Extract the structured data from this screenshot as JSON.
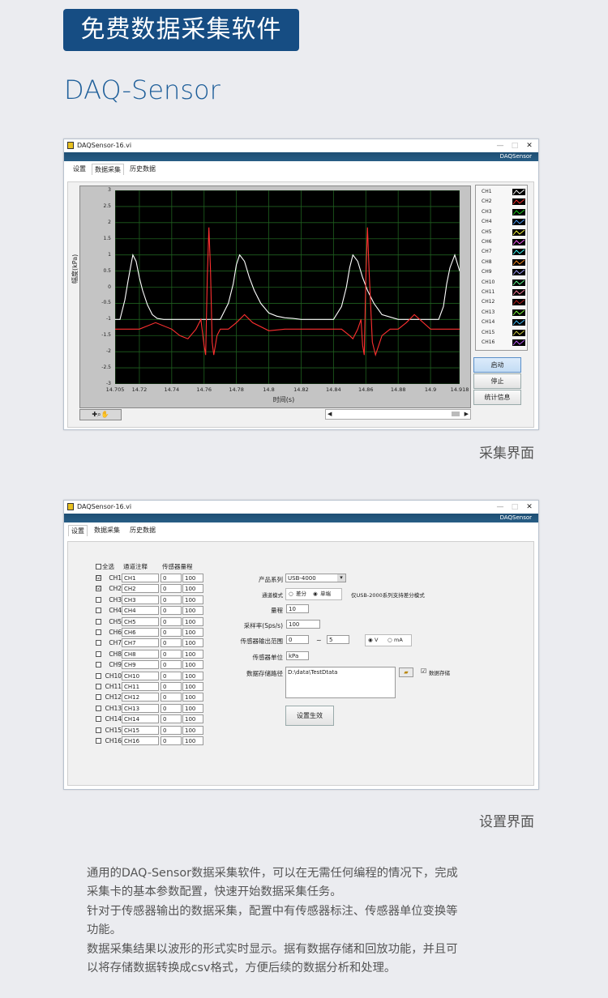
{
  "banner": "免费数据采集软件",
  "product": "DAQ-Sensor",
  "window": {
    "title": "DAQSensor-16.vi",
    "brand": "DAQSensor",
    "controls": [
      "—",
      "□",
      "✕"
    ],
    "tabs": [
      "设置",
      "数据采集",
      "历史数据"
    ]
  },
  "acq": {
    "yaxis_label": "幅度(kPa)",
    "xaxis_label": "时间(s)",
    "y_ticks": [
      "3",
      "2.5",
      "2",
      "1.5",
      "1",
      "0.5",
      "0",
      "-0.5",
      "-1",
      "-1.5",
      "-2",
      "-2.5",
      "-3"
    ],
    "x_ticks": [
      "14.705",
      "14.72",
      "14.74",
      "14.76",
      "14.78",
      "14.8",
      "14.82",
      "14.84",
      "14.86",
      "14.88",
      "14.9",
      "14.918"
    ],
    "legend": [
      "CH1",
      "CH2",
      "CH3",
      "CH4",
      "CH5",
      "CH6",
      "CH7",
      "CH8",
      "CH9",
      "CH10",
      "CH11",
      "CH12",
      "CH13",
      "CH14",
      "CH15",
      "CH16"
    ],
    "legend_colors": [
      "#ffffff",
      "#ff3030",
      "#20d020",
      "#4aa0ff",
      "#ffff40",
      "#ff60ff",
      "#40ffff",
      "#ff9020",
      "#a0a0ff",
      "#60ff90",
      "#ff80a0",
      "#c02020",
      "#80ff40",
      "#40c0ff",
      "#d0d040",
      "#c060ff"
    ],
    "buttons": {
      "start": "启动",
      "stop": "停止",
      "stats": "统计信息"
    },
    "caption": "采集界面"
  },
  "chart_data": {
    "type": "line",
    "xlabel": "时间(s)",
    "ylabel": "幅度(kPa)",
    "xlim": [
      14.705,
      14.918
    ],
    "ylim": [
      -3,
      3
    ],
    "grid": true,
    "series": [
      {
        "name": "CH1",
        "color": "#ffffff",
        "x": [
          14.705,
          14.708,
          14.711,
          14.713,
          14.715,
          14.716,
          14.718,
          14.72,
          14.722,
          14.725,
          14.728,
          14.731,
          14.735,
          14.74,
          14.745,
          14.75,
          14.76,
          14.77,
          14.775,
          14.778,
          14.78,
          14.782,
          14.785,
          14.788,
          14.791,
          14.795,
          14.8,
          14.805,
          14.81,
          14.815,
          14.82,
          14.83,
          14.84,
          14.845,
          14.848,
          14.85,
          14.852,
          14.855,
          14.858,
          14.861,
          14.865,
          14.87,
          14.88,
          14.89,
          14.9,
          14.905,
          14.908,
          14.91,
          14.912,
          14.915,
          14.918
        ],
        "values": [
          -1.0,
          -1.0,
          -0.4,
          0.2,
          0.75,
          1.0,
          0.8,
          0.3,
          -0.1,
          -0.55,
          -0.85,
          -0.97,
          -1.0,
          -1.0,
          -1.0,
          -1.0,
          -1.0,
          -1.0,
          -0.5,
          0.1,
          0.7,
          1.0,
          0.8,
          0.3,
          -0.1,
          -0.5,
          -0.8,
          -0.9,
          -0.95,
          -0.97,
          -1.0,
          -1.0,
          -1.0,
          -0.6,
          0.0,
          0.6,
          1.0,
          0.8,
          0.3,
          -0.1,
          -0.5,
          -0.85,
          -1.0,
          -1.0,
          -1.0,
          -1.0,
          -0.6,
          0.1,
          0.6,
          1.0,
          0.5
        ]
      },
      {
        "name": "CH2",
        "color": "#ff3030",
        "x": [
          14.705,
          14.71,
          14.72,
          14.73,
          14.74,
          14.745,
          14.75,
          14.755,
          14.758,
          14.76,
          14.761,
          14.762,
          14.763,
          14.764,
          14.765,
          14.766,
          14.768,
          14.77,
          14.775,
          14.78,
          14.785,
          14.79,
          14.8,
          14.81,
          14.82,
          14.83,
          14.84,
          14.845,
          14.85,
          14.852,
          14.855,
          14.857,
          14.858,
          14.859,
          14.86,
          14.861,
          14.862,
          14.864,
          14.866,
          14.87,
          14.875,
          14.88,
          14.885,
          14.89,
          14.9,
          14.91,
          14.918
        ],
        "values": [
          -1.3,
          -1.3,
          -1.3,
          -1.1,
          -1.3,
          -1.5,
          -1.6,
          -1.3,
          -1.0,
          -1.8,
          -2.1,
          0.3,
          1.85,
          0.5,
          -1.7,
          -2.1,
          -1.5,
          -1.3,
          -1.3,
          -1.1,
          -0.85,
          -1.1,
          -1.35,
          -1.3,
          -1.3,
          -1.3,
          -1.3,
          -1.3,
          -1.5,
          -1.6,
          -1.3,
          -1.0,
          -1.8,
          -2.1,
          0.3,
          1.85,
          0.5,
          -1.7,
          -2.1,
          -1.5,
          -1.3,
          -1.3,
          -1.1,
          -0.85,
          -1.3,
          -1.3,
          -1.3
        ]
      }
    ]
  },
  "settings": {
    "headers": {
      "all": "全选",
      "note": "通道注释",
      "range": "传感器量程"
    },
    "channels": [
      {
        "label": "CH1",
        "note": "CH1",
        "lo": "0",
        "hi": "100",
        "checked": "☑"
      },
      {
        "label": "CH2",
        "note": "CH2",
        "lo": "0",
        "hi": "100",
        "checked": "☑"
      },
      {
        "label": "CH3",
        "note": "CH3",
        "lo": "0",
        "hi": "100",
        "checked": ""
      },
      {
        "label": "CH4",
        "note": "CH4",
        "lo": "0",
        "hi": "100",
        "checked": ""
      },
      {
        "label": "CH5",
        "note": "CH5",
        "lo": "0",
        "hi": "100",
        "checked": ""
      },
      {
        "label": "CH6",
        "note": "CH6",
        "lo": "0",
        "hi": "100",
        "checked": ""
      },
      {
        "label": "CH7",
        "note": "CH7",
        "lo": "0",
        "hi": "100",
        "checked": ""
      },
      {
        "label": "CH8",
        "note": "CH8",
        "lo": "0",
        "hi": "100",
        "checked": ""
      },
      {
        "label": "CH9",
        "note": "CH9",
        "lo": "0",
        "hi": "100",
        "checked": ""
      },
      {
        "label": "CH10",
        "note": "CH10",
        "lo": "0",
        "hi": "100",
        "checked": ""
      },
      {
        "label": "CH11",
        "note": "CH11",
        "lo": "0",
        "hi": "100",
        "checked": ""
      },
      {
        "label": "CH12",
        "note": "CH12",
        "lo": "0",
        "hi": "100",
        "checked": ""
      },
      {
        "label": "CH13",
        "note": "CH13",
        "lo": "0",
        "hi": "100",
        "checked": ""
      },
      {
        "label": "CH14",
        "note": "CH14",
        "lo": "0",
        "hi": "100",
        "checked": ""
      },
      {
        "label": "CH15",
        "note": "CH15",
        "lo": "0",
        "hi": "100",
        "checked": ""
      },
      {
        "label": "CH16",
        "note": "CH16",
        "lo": "0",
        "hi": "100",
        "checked": ""
      }
    ],
    "product_series_label": "产品系列",
    "product_series_value": "USB-4000",
    "channel_mode_label": "通道模式",
    "mode_diff": "差分",
    "mode_single": "单端",
    "mode_note": "仅USB-2000系列支持差分模式",
    "range_label": "量程",
    "range_value": "10",
    "rate_label": "采样率(Sps/s)",
    "rate_value": "100",
    "output_label": "传感器输出范围",
    "output_lo": "0",
    "output_tilde": "~",
    "output_hi": "5",
    "unit_v": "V",
    "unit_ma": "mA",
    "sensor_unit_label": "传感器单位",
    "sensor_unit_value": "kPa",
    "path_label": "数据存储路径",
    "path_value": "D:\\data\\TestDtata",
    "save_checkbox_label": "数据存储",
    "apply_button": "设置生效",
    "caption": "设置界面"
  },
  "description": [
    "通用的DAQ-Sensor数据采集软件，可以在无需任何编程的情况下，完成",
    "采集卡的基本参数配置，快速开始数据采集任务。",
    "针对于传感器输出的数据采集，配置中有传感器标注、传感器单位变换等",
    "功能。",
    "数据采集结果以波形的形式实时显示。据有数据存储和回放功能，并且可",
    "以将存储数据转换成csv格式，方便后续的数据分析和处理。"
  ]
}
